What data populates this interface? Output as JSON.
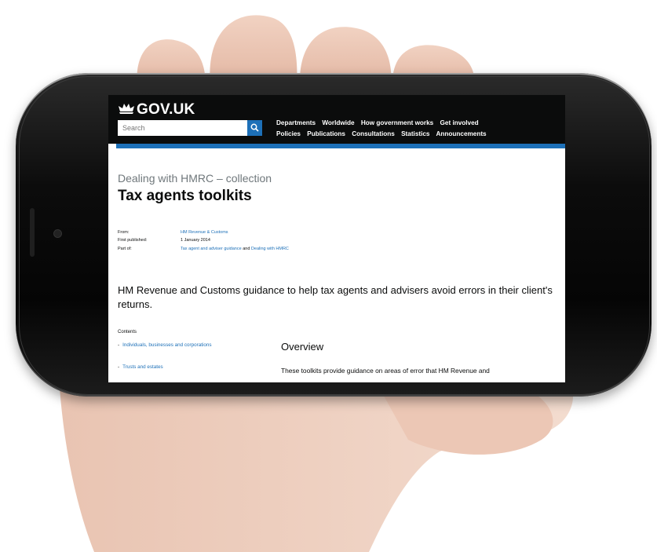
{
  "header": {
    "logo": "GOV.UK",
    "search_placeholder": "Search",
    "nav_row1": [
      "Departments",
      "Worldwide",
      "How government works",
      "Get involved"
    ],
    "nav_row2": [
      "Policies",
      "Publications",
      "Consultations",
      "Statistics",
      "Announcements"
    ]
  },
  "page": {
    "collection_label": "Dealing with HMRC – collection",
    "title": "Tax agents toolkits",
    "meta": {
      "from_label": "From:",
      "from_value": "HM Revenue & Customs",
      "published_label": "First published:",
      "published_value": "1 January 2014",
      "partof_label": "Part of:",
      "partof_link1": "Tax agent and adviser guidance",
      "partof_and": "and",
      "partof_link2": "Dealing with HMRC"
    },
    "lead": "HM Revenue and Customs guidance to help tax agents and advisers avoid errors in their client's returns.",
    "contents_heading": "Contents",
    "contents": [
      "Individuals, businesses and corporations",
      "Trusts and estates"
    ],
    "overview_heading": "Overview",
    "overview_text": "These toolkits provide guidance on areas of error that HM Revenue and"
  },
  "colors": {
    "header_bg": "#0b0c0c",
    "brand_blue": "#1d70b8",
    "link": "#1d70b8",
    "secondary_text": "#6f777b"
  }
}
